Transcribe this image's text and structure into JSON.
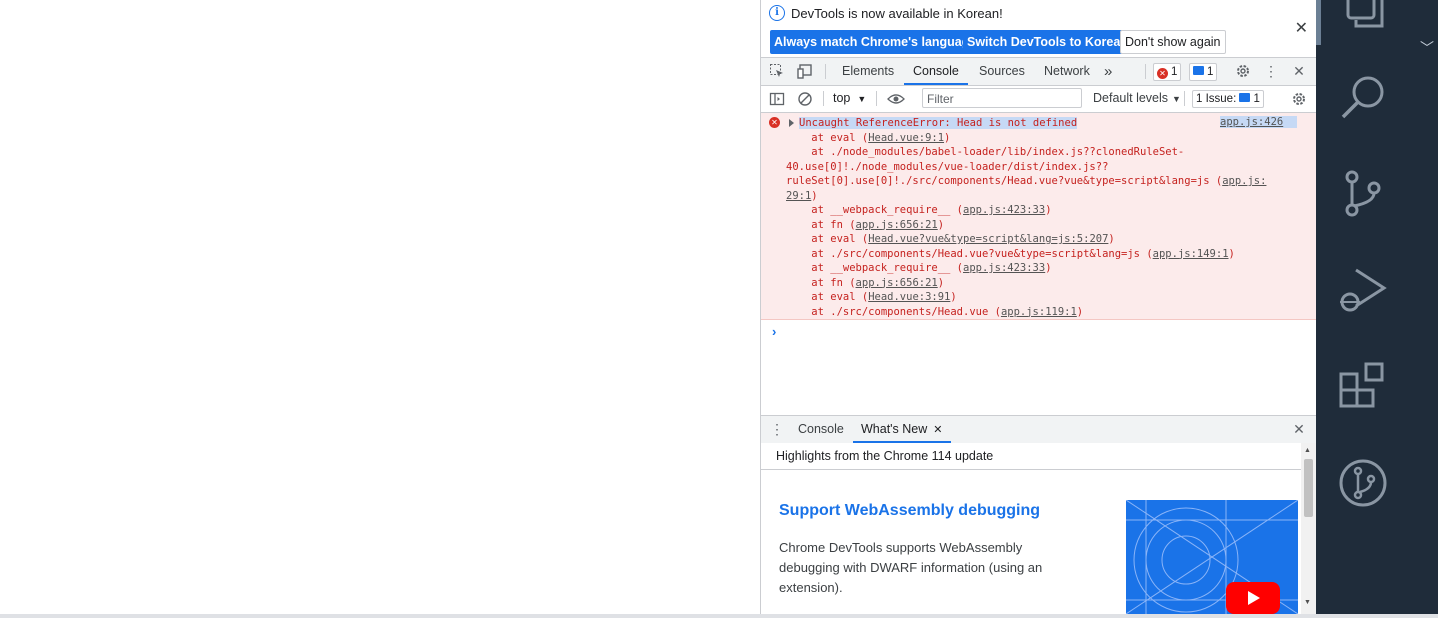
{
  "infobar": {
    "message": "DevTools is now available in Korean!",
    "btn_match": "Always match Chrome's language",
    "btn_switch": "Switch DevTools to Korean",
    "btn_dont": "Don't show again"
  },
  "tabs": {
    "items": [
      "Elements",
      "Console",
      "Sources",
      "Network"
    ],
    "active": "Console",
    "more": "»",
    "error_count": "1",
    "message_count": "1"
  },
  "console_toolbar": {
    "context": "top",
    "filter_placeholder": "Filter",
    "levels": "Default levels",
    "issues_label": "1 Issue:",
    "issues_count": "1"
  },
  "error": {
    "source": "app.js:426",
    "lines": [
      [
        {
          "t": "Uncaught ReferenceError: Head is not defined"
        }
      ],
      [
        {
          "t": "    at eval ("
        },
        {
          "t": "Head.vue:9:1",
          "link": true
        },
        {
          "t": ")"
        }
      ],
      [
        {
          "t": "    at ./node_modules/babel-loader/lib/index.js??clonedRuleSet-"
        }
      ],
      [
        {
          "t": "40.use[0]!./node_modules/vue-loader/dist/index.js??"
        }
      ],
      [
        {
          "t": "ruleSet[0].use[0]!./src/components/Head.vue?vue&type=script&lang=js ("
        },
        {
          "t": "app.js:",
          "link": true
        }
      ],
      [
        {
          "t": "29:1",
          "link": true
        },
        {
          "t": ")"
        }
      ],
      [
        {
          "t": "    at __webpack_require__ ("
        },
        {
          "t": "app.js:423:33",
          "link": true
        },
        {
          "t": ")"
        }
      ],
      [
        {
          "t": "    at fn ("
        },
        {
          "t": "app.js:656:21",
          "link": true
        },
        {
          "t": ")"
        }
      ],
      [
        {
          "t": "    at eval ("
        },
        {
          "t": "Head.vue?vue&type=script&lang=js:5:207",
          "link": true
        },
        {
          "t": ")"
        }
      ],
      [
        {
          "t": "    at ./src/components/Head.vue?vue&type=script&lang=js ("
        },
        {
          "t": "app.js:149:1",
          "link": true
        },
        {
          "t": ")"
        }
      ],
      [
        {
          "t": "    at __webpack_require__ ("
        },
        {
          "t": "app.js:423:33",
          "link": true
        },
        {
          "t": ")"
        }
      ],
      [
        {
          "t": "    at fn ("
        },
        {
          "t": "app.js:656:21",
          "link": true
        },
        {
          "t": ")"
        }
      ],
      [
        {
          "t": "    at eval ("
        },
        {
          "t": "Head.vue:3:91",
          "link": true
        },
        {
          "t": ")"
        }
      ],
      [
        {
          "t": "    at ./src/components/Head.vue ("
        },
        {
          "t": "app.js:119:1",
          "link": true
        },
        {
          "t": ")"
        }
      ]
    ],
    "prompt": "›"
  },
  "drawer": {
    "tabs": [
      "Console",
      "What's New"
    ],
    "active": "What's New",
    "highlights": "Highlights from the Chrome 114 update",
    "whats_new_title": "Support WebAssembly debugging",
    "whats_new_desc": "Chrome DevTools supports WebAssembly debugging with DWARF information (using an extension)."
  },
  "colors": {
    "accent": "#1a73e8",
    "error": "#d93025",
    "error_bg": "#fcebeb",
    "activity_bar": "#1f2c3a"
  },
  "activity_icons": [
    "copy-icon",
    "search-icon",
    "source-control-icon",
    "run-debug-icon",
    "extensions-icon",
    "git-graph-icon"
  ]
}
